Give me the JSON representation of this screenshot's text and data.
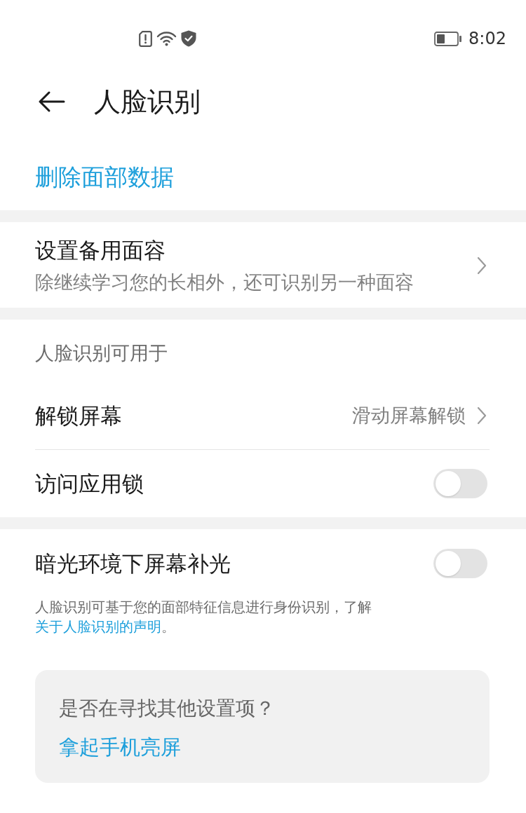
{
  "status_bar": {
    "time": "8:02"
  },
  "header": {
    "title": "人脸识别"
  },
  "delete_action": {
    "label": "删除面部数据"
  },
  "sections": [
    {
      "items": [
        {
          "kind": "nav",
          "title": "设置备用面容",
          "subtitle": "除继续学习您的长相外，还可识别另一种面容"
        }
      ]
    },
    {
      "header": "人脸识别可用于",
      "items": [
        {
          "kind": "nav",
          "title": "解锁屏幕",
          "value": "滑动屏幕解锁"
        },
        {
          "kind": "toggle",
          "title": "访问应用锁",
          "on": false
        }
      ]
    },
    {
      "items": [
        {
          "kind": "toggle",
          "title": "暗光环境下屏幕补光",
          "on": false
        }
      ],
      "footnote": {
        "text": "人脸识别可基于您的面部特征信息进行身份识别，了解",
        "link": "关于人脸识别的声明",
        "end": "。"
      }
    }
  ],
  "suggestion": {
    "question": "是否在寻找其他设置项？",
    "link": "拿起手机亮屏"
  }
}
